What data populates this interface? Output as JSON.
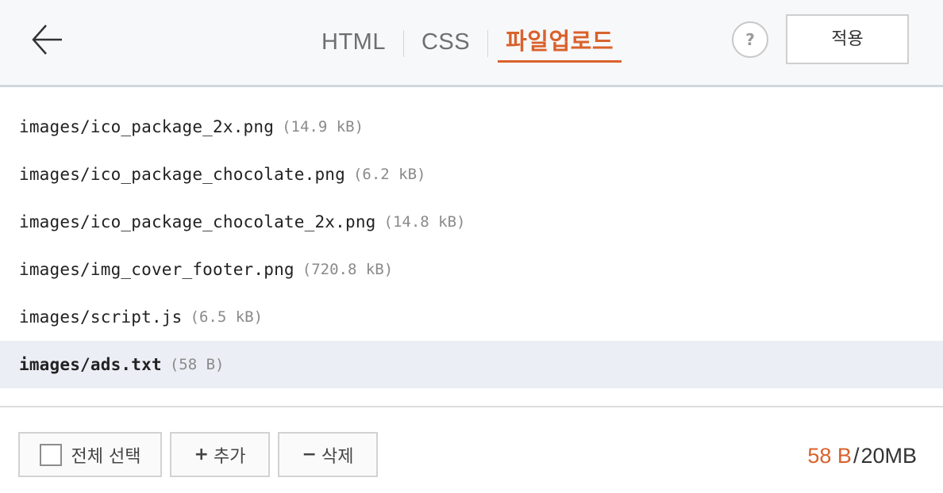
{
  "header": {
    "tabs": [
      {
        "label": "HTML",
        "active": false
      },
      {
        "label": "CSS",
        "active": false
      },
      {
        "label": "파일업로드",
        "active": true
      }
    ],
    "help_label": "?",
    "apply_label": "적용",
    "back_icon": "arrow-left-icon"
  },
  "files": [
    {
      "name": "images/ico_package_2x.png",
      "size": "(14.9 kB)"
    },
    {
      "name": "images/ico_package_chocolate.png",
      "size": "(6.2 kB)"
    },
    {
      "name": "images/ico_package_chocolate_2x.png",
      "size": "(14.8 kB)"
    },
    {
      "name": "images/img_cover_footer.png",
      "size": "(720.8 kB)"
    },
    {
      "name": "images/script.js",
      "size": "(6.5 kB)"
    },
    {
      "name": "images/ads.txt",
      "size": "(58 B)",
      "selected": true
    }
  ],
  "footer": {
    "select_all_label": "전체 선택",
    "add_label": "추가",
    "add_symbol": "+",
    "delete_label": "삭제",
    "delete_symbol": "−",
    "used": "58 B",
    "separator": "/",
    "limit": "20MB"
  },
  "colors": {
    "accent": "#d9622b",
    "selected_row": "#ebeef5",
    "header_bg": "#f7f8fa"
  }
}
